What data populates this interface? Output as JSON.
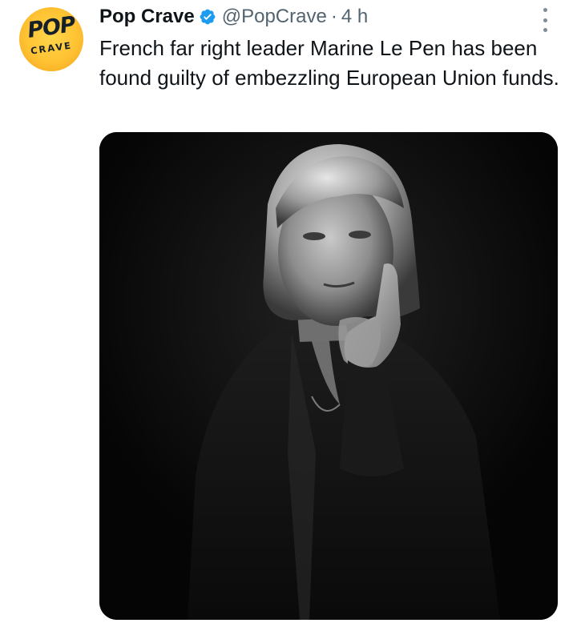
{
  "tweet": {
    "author_name": "Pop Crave",
    "handle": "@PopCrave",
    "separator": "·",
    "time": "4 h",
    "text": "French far right leader Marine Le Pen has been found guilty of embezzling European Union funds.",
    "verified_color": "#1d9bf0",
    "avatar": {
      "logo_top": "POP",
      "logo_bottom": "CRAVE",
      "bg_color": "#ffc233"
    },
    "icons": {
      "verified": "verified-badge-icon",
      "more": "more-vertical-icon"
    },
    "media_alt": "Black and white portrait photo of a blonde woman in a dark jacket, hand raised to her chin"
  }
}
